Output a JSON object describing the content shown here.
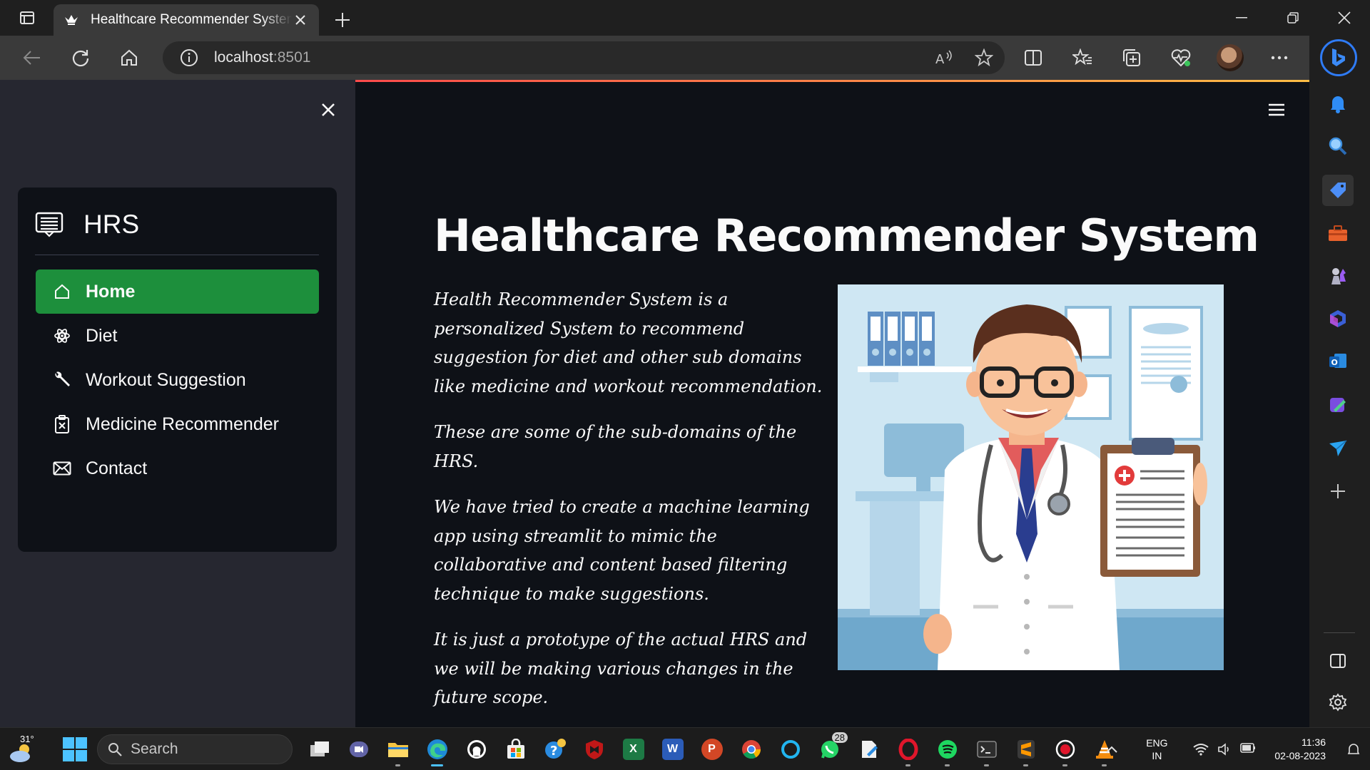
{
  "browser": {
    "tab_title": "Healthcare Recommender System",
    "url_host": "localhost",
    "url_port": ":8501"
  },
  "sidebar": {
    "menu_title": "HRS",
    "items": [
      {
        "label": "Home",
        "icon": "house-icon",
        "active": true
      },
      {
        "label": "Diet",
        "icon": "atom-icon",
        "active": false
      },
      {
        "label": "Workout Suggestion",
        "icon": "wrench-icon",
        "active": false
      },
      {
        "label": "Medicine Recommender",
        "icon": "clipboard-icon",
        "active": false
      },
      {
        "label": "Contact",
        "icon": "envelope-icon",
        "active": false
      }
    ],
    "active_color": "#1d8f3c"
  },
  "main": {
    "title": "Healthcare Recommender System",
    "paragraphs": [
      "Health Recommender System is a personalized System to recommend suggestion for diet and other sub domains like medicine and workout recommendation.",
      "These are some of the sub-domains of the HRS.",
      "We have tried to create a machine learning app using streamlit to mimic the collaborative and content based filtering technique to make suggestions.",
      "It is just a prototype of the actual HRS and we will be making various changes in the future scope."
    ],
    "image": "doctor-illustration"
  },
  "taskbar": {
    "temperature": "31°",
    "search_label": "Search",
    "whatsapp_badge": "28",
    "lang_line1": "ENG",
    "lang_line2": "IN",
    "time": "11:36",
    "date": "02-08-2023"
  }
}
